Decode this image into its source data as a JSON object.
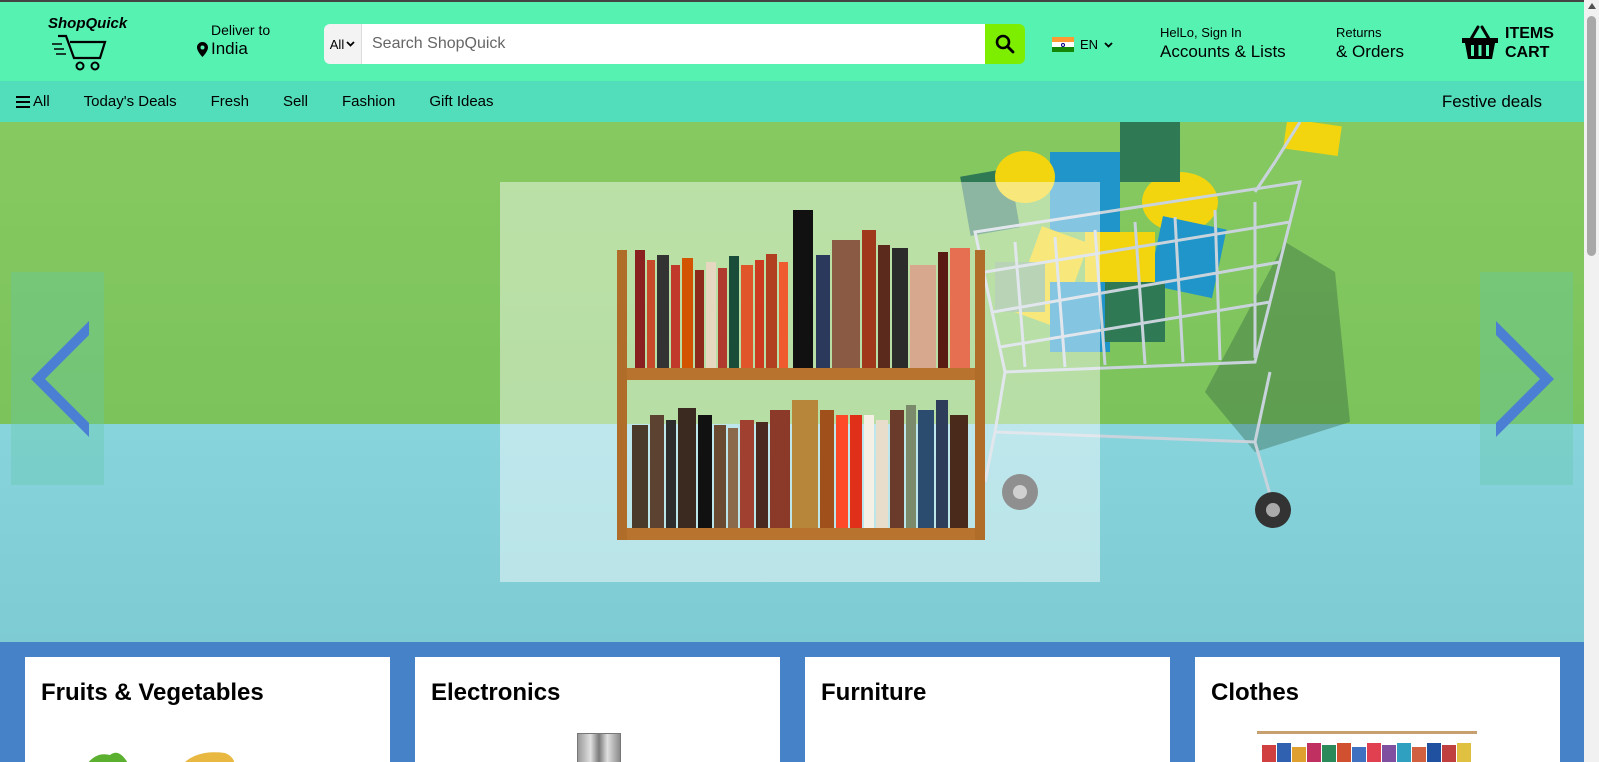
{
  "header": {
    "logo_text": "ShopQuick",
    "deliver_label": "Deliver to",
    "deliver_country": "India",
    "search_category": "All",
    "search_placeholder": "Search ShopQuick",
    "language": "EN",
    "account_greeting": "HelLo, Sign In",
    "account_label": "Accounts & Lists",
    "orders_small": "Returns",
    "orders_label": "& Orders",
    "cart_line1": "ITEMS",
    "cart_line2": "CART"
  },
  "nav": {
    "all_label": "All",
    "items": [
      "Today's Deals",
      "Fresh",
      "Sell",
      "Fashion",
      "Gift Ideas"
    ],
    "festive_label": "Festive deals"
  },
  "categories": [
    {
      "title": "Fruits & Vegetables"
    },
    {
      "title": "Electronics"
    },
    {
      "title": "Furniture"
    },
    {
      "title": "Clothes"
    }
  ],
  "colors": {
    "header_bg": "#55f2b2",
    "nav_bg": "#52deba",
    "search_button": "#7dee00",
    "category_strip": "#4682c8",
    "carousel_arrow": "#4a7fd4"
  },
  "icons": {
    "search": "search-icon",
    "location": "location-pin-icon",
    "cart": "basket-icon",
    "menu": "hamburger-icon",
    "chevron": "chevron-down-icon",
    "prev": "chevron-left-icon",
    "next": "chevron-right-icon"
  }
}
